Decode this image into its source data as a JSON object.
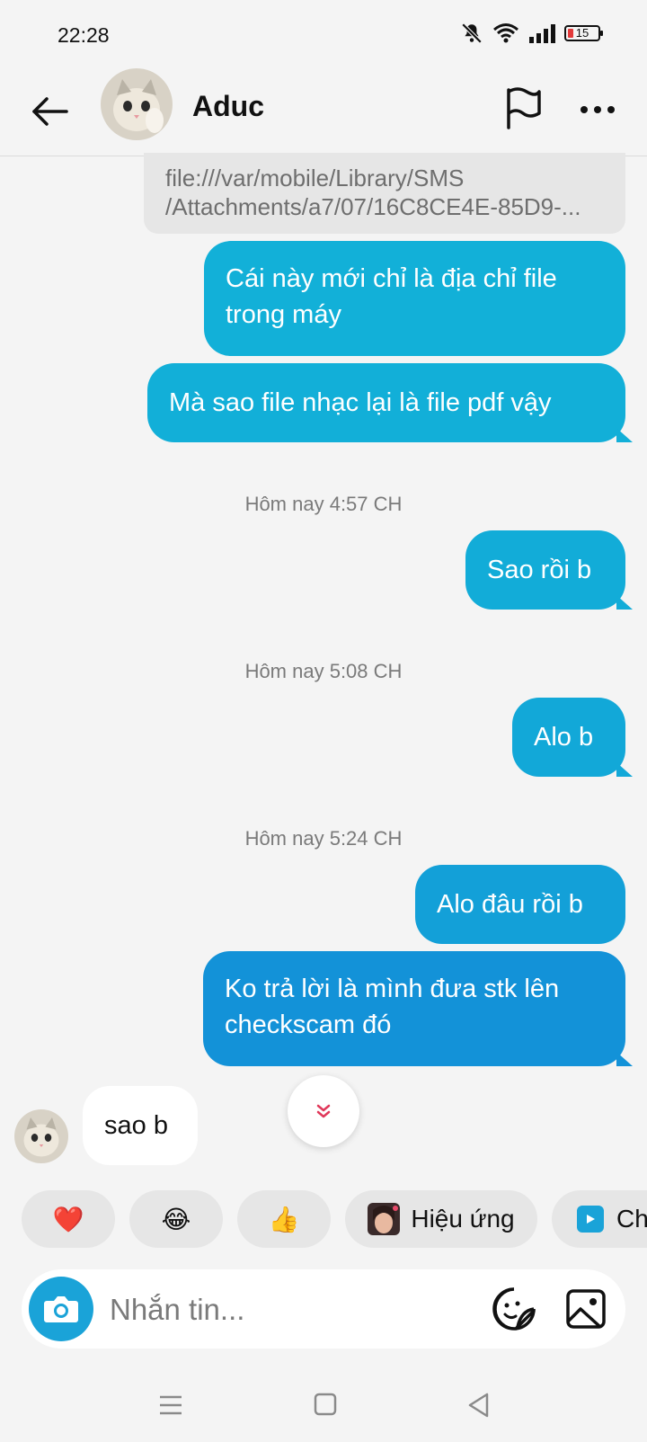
{
  "status_bar": {
    "time": "22:28",
    "battery": "15",
    "icons": [
      "bell-muted-icon",
      "wifi-icon",
      "signal-icon",
      "battery-icon"
    ]
  },
  "header": {
    "contact_name": "Aduc",
    "icons": [
      "back-arrow-icon",
      "flag-icon",
      "more-icon"
    ]
  },
  "messages": [
    {
      "type": "file",
      "lines": [
        "file:///var/mobile/Library/SMS",
        "/Attachments/a7/07/16C8CE4E-85D9-..."
      ]
    },
    {
      "type": "outgoing",
      "text": "Cái này mới chỉ là địa chỉ file trong máy"
    },
    {
      "type": "outgoing",
      "text": "Mà sao file nhạc lại là file pdf vậy"
    },
    {
      "type": "timestamp",
      "text": "Hôm nay 4:57 CH"
    },
    {
      "type": "outgoing",
      "text": "Sao rồi b"
    },
    {
      "type": "timestamp",
      "text": "Hôm nay 5:08 CH"
    },
    {
      "type": "outgoing",
      "text": "Alo b"
    },
    {
      "type": "timestamp",
      "text": "Hôm nay 5:24 CH"
    },
    {
      "type": "outgoing",
      "text": "Alo đâu rồi b"
    },
    {
      "type": "outgoing",
      "text": "Ko trả lời là mình đưa stk lên checkscam đó"
    },
    {
      "type": "incoming",
      "text": "sao b"
    }
  ],
  "quick_replies": {
    "heart": "❤️",
    "laugh": "😂",
    "thumbs": "👍",
    "effects_label": "Hiệu ứng",
    "next_label": "Ch"
  },
  "composer": {
    "placeholder": "Nhắn tin..."
  },
  "colors": {
    "bubble_top": "#12b2d6",
    "bubble_bottom": "#138fd8",
    "accent": "#1aa3d8",
    "background": "#f4f4f4"
  }
}
